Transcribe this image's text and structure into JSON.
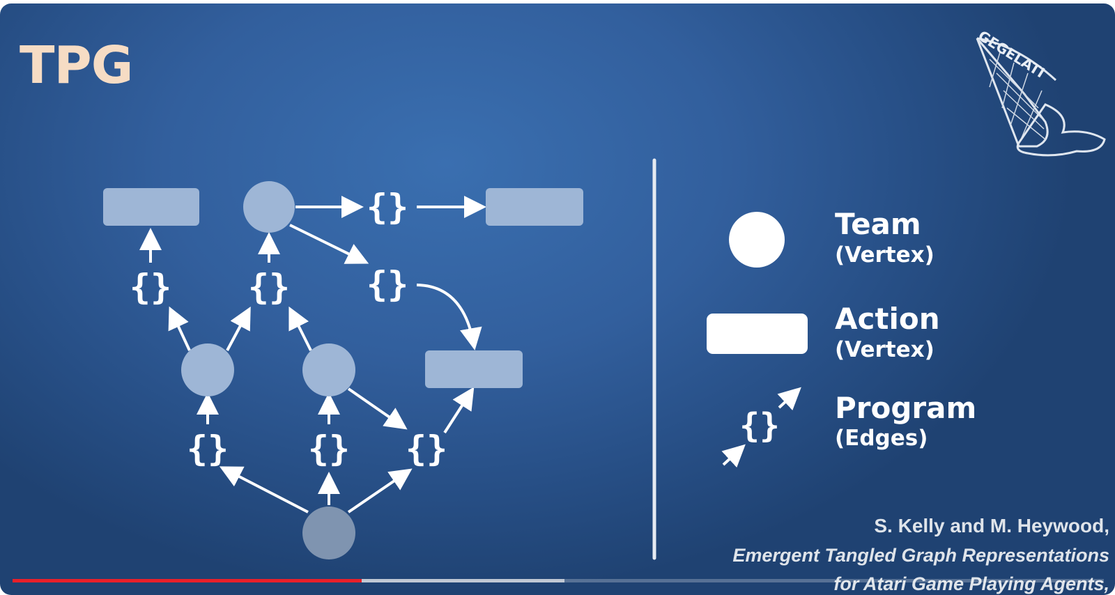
{
  "slide": {
    "title": "TPG",
    "logo_text": "GEGELATI"
  },
  "diagram": {
    "program_glyph": "{}"
  },
  "legend": {
    "team": {
      "name": "Team",
      "kind": "(Vertex)"
    },
    "action": {
      "name": "Action",
      "kind": "(Vertex)"
    },
    "program": {
      "name": "Program",
      "kind": "(Edges)"
    }
  },
  "citation": {
    "authors": "S. Kelly and M. Heywood,",
    "title_line1": "Emergent Tangled Graph Representations",
    "title_line2": "for Atari Game Playing Agents,"
  },
  "player": {
    "played_fraction": 0.32,
    "buffered_fraction": 0.506
  },
  "colors": {
    "background": "#325f9d",
    "title": "#f6dcc4",
    "node_fill": "#9eb6d6",
    "root_fill": "#7f94b0",
    "legend_white": "#ffffff",
    "progress_played": "#e8202a"
  }
}
